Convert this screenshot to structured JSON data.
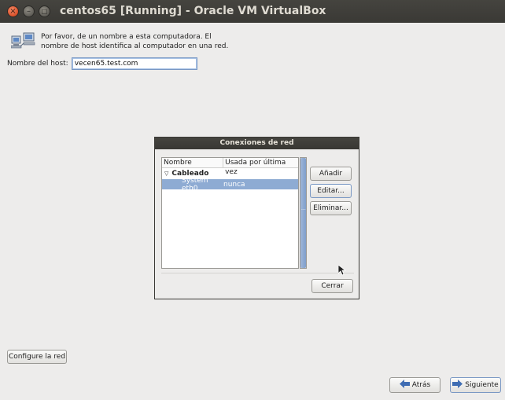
{
  "window": {
    "title": "centos65 [Running] - Oracle VM VirtualBox",
    "close_glyph": "×",
    "minimize_glyph": "–",
    "maximize_glyph": "□"
  },
  "page": {
    "intro_text": "Por favor, de un nombre a esta computadora. El nombre de host identifica al computador en una red.",
    "hostname_label": "Nombre del host:",
    "hostname_value": "vecen65.test.com",
    "configure_network_label": "Configure la red",
    "back_label": "Atrás",
    "next_label": "Siguiente"
  },
  "dialog": {
    "title": "Conexiones de red",
    "columns": [
      "Nombre",
      "Usada por última vez"
    ],
    "group": "Cableado",
    "rows": [
      {
        "name": "System eth0",
        "last_used": "nunca"
      }
    ],
    "add_label": "Añadir",
    "edit_label": "Editar...",
    "delete_label": "Eliminar...",
    "close_label": "Cerrar"
  },
  "icons": {
    "intro": "network-computers-icon",
    "back": "arrow-left-icon",
    "next": "arrow-right-icon"
  },
  "colors": {
    "selection": "#8eabd3",
    "titlebar": "#3c3b37",
    "close_button": "#e0592f"
  }
}
